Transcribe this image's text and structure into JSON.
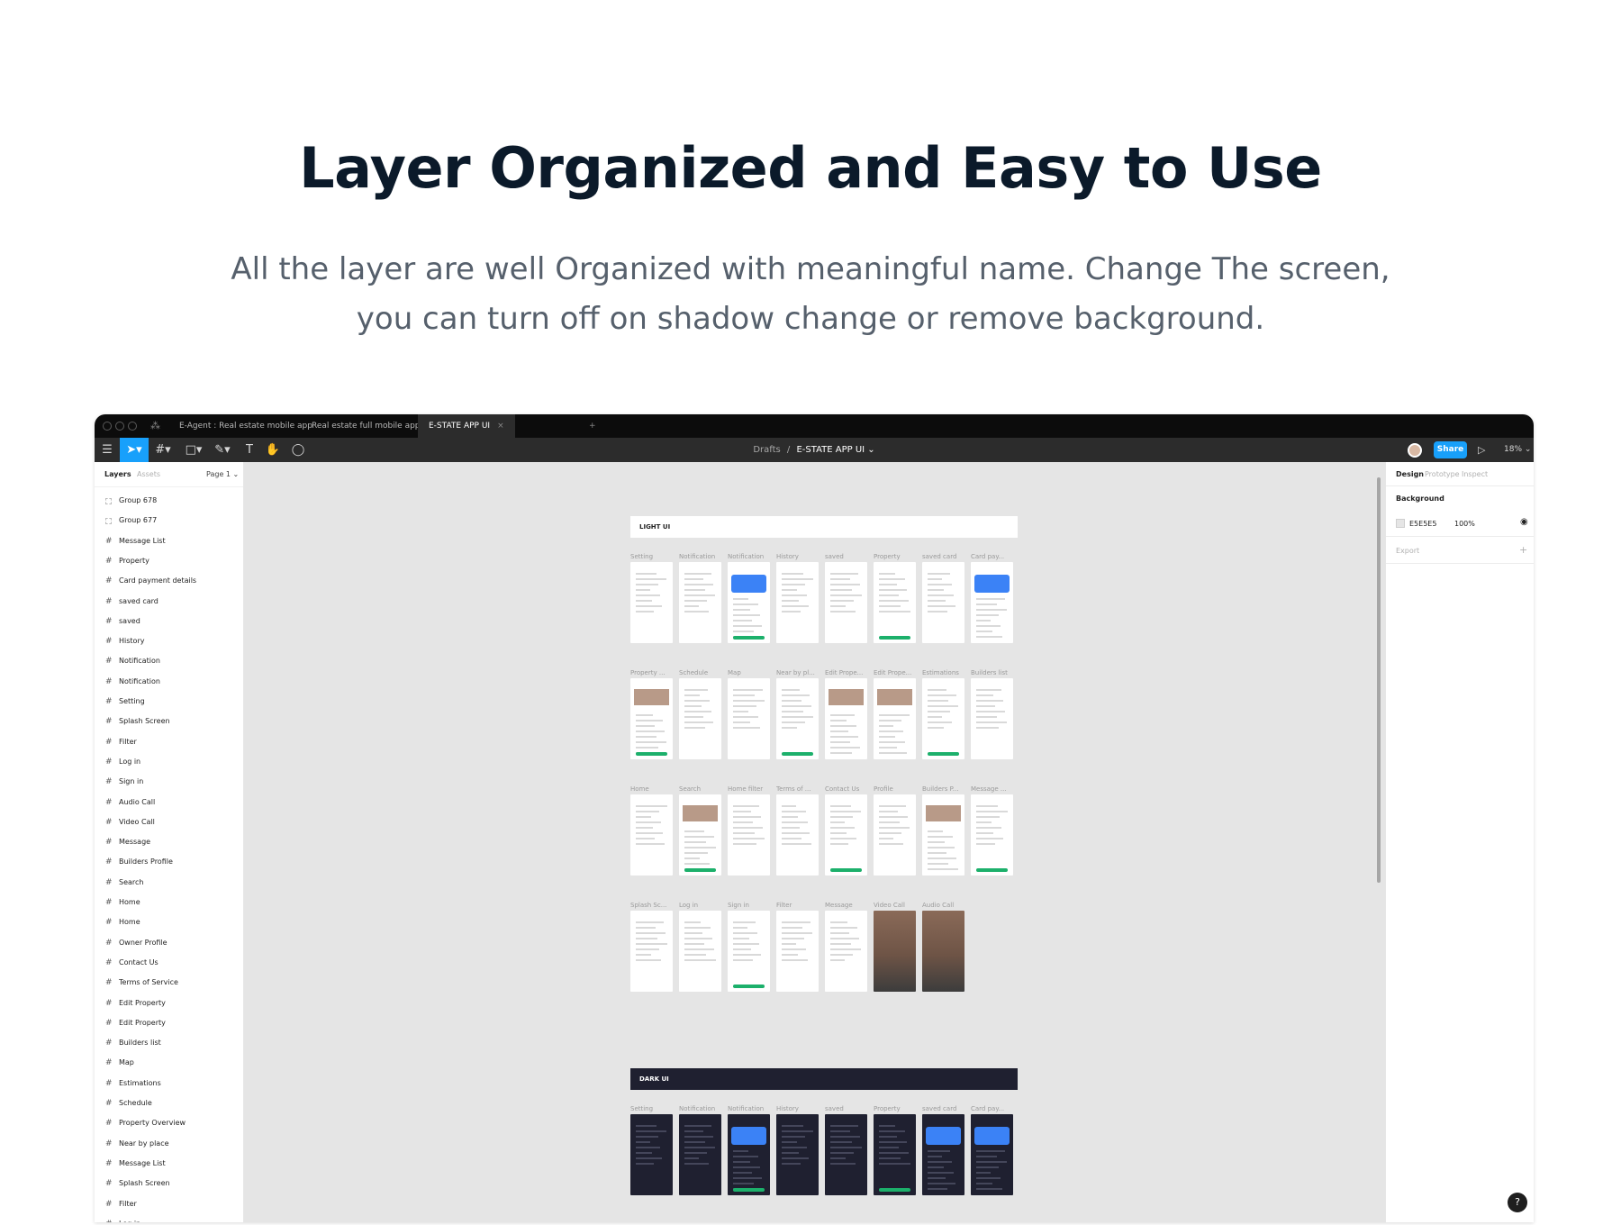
{
  "hero": {
    "title": "Layer Organized and Easy to Use",
    "subtitle_line1": "All the layer are well Organized with meaningful name. Change The screen,",
    "subtitle_line2": "you can turn off on shadow change or remove background."
  },
  "window": {
    "tabs": [
      {
        "label": "E-Agent : Real estate mobile app"
      },
      {
        "label": "Real estate full mobile app"
      },
      {
        "label": "E-STATE APP UI"
      }
    ],
    "add_tab": "+"
  },
  "toolbar": {
    "breadcrumb_root": "Drafts",
    "breadcrumb_sep": "/",
    "file_name": "E-STATE APP UI",
    "share_label": "Share",
    "zoom_label": "18%"
  },
  "left_panel": {
    "tab_layers": "Layers",
    "tab_assets": "Assets",
    "page_label": "Page 1",
    "layers": [
      {
        "name": "Group 678",
        "kind": "group"
      },
      {
        "name": "Group 677",
        "kind": "group"
      },
      {
        "name": "Message List",
        "kind": "frame"
      },
      {
        "name": "Property",
        "kind": "frame"
      },
      {
        "name": "Card payment details",
        "kind": "frame"
      },
      {
        "name": "saved card",
        "kind": "frame"
      },
      {
        "name": "saved",
        "kind": "frame"
      },
      {
        "name": "History",
        "kind": "frame"
      },
      {
        "name": "Notification",
        "kind": "frame"
      },
      {
        "name": "Notification",
        "kind": "frame"
      },
      {
        "name": "Setting",
        "kind": "frame"
      },
      {
        "name": "Splash Screen",
        "kind": "frame"
      },
      {
        "name": "Filter",
        "kind": "frame"
      },
      {
        "name": "Log in",
        "kind": "frame"
      },
      {
        "name": "Sign in",
        "kind": "frame"
      },
      {
        "name": "Audio Call",
        "kind": "frame"
      },
      {
        "name": "Video Call",
        "kind": "frame"
      },
      {
        "name": "Message",
        "kind": "frame"
      },
      {
        "name": "Builders Profile",
        "kind": "frame"
      },
      {
        "name": "Search",
        "kind": "frame"
      },
      {
        "name": "Home",
        "kind": "frame"
      },
      {
        "name": "Home",
        "kind": "frame"
      },
      {
        "name": "Owner Profile",
        "kind": "frame"
      },
      {
        "name": "Contact Us",
        "kind": "frame"
      },
      {
        "name": "Terms of Service",
        "kind": "frame"
      },
      {
        "name": "Edit Property",
        "kind": "frame"
      },
      {
        "name": "Edit Property",
        "kind": "frame"
      },
      {
        "name": "Builders list",
        "kind": "frame"
      },
      {
        "name": "Map",
        "kind": "frame"
      },
      {
        "name": "Estimations",
        "kind": "frame"
      },
      {
        "name": "Schedule",
        "kind": "frame"
      },
      {
        "name": "Property Overview",
        "kind": "frame"
      },
      {
        "name": "Near by place",
        "kind": "frame"
      },
      {
        "name": "Message List",
        "kind": "frame"
      },
      {
        "name": "Splash Screen",
        "kind": "frame"
      },
      {
        "name": "Filter",
        "kind": "frame"
      },
      {
        "name": "Log in",
        "kind": "frame"
      }
    ]
  },
  "right_panel": {
    "tab_design": "Design",
    "tab_prototype": "Prototype",
    "tab_inspect": "Inspect",
    "background_label": "Background",
    "background_hex": "E5E5E5",
    "background_opacity": "100%",
    "export_label": "Export",
    "export_add": "+"
  },
  "canvas": {
    "light_label": "LIGHT UI",
    "dark_label": "DARK UI",
    "light_rows": [
      [
        "Setting",
        "Notification",
        "Notification",
        "History",
        "saved",
        "Property",
        "saved card",
        "Card pay..."
      ],
      [
        "Property ...",
        "Schedule",
        "Map",
        "Near by pl...",
        "Edit Prope...",
        "Edit Prope...",
        "Estimations",
        "Builders list"
      ],
      [
        "Home",
        "Search",
        "Home filter",
        "Terms of ...",
        "Contact Us",
        "Profile",
        "Builders P...",
        "Message ..."
      ],
      [
        "Splash Sc...",
        "Log in",
        "Sign in",
        "Filter",
        "Message",
        "Video Call",
        "Audio Call"
      ]
    ],
    "dark_rows": [
      [
        "Setting",
        "Notification",
        "Notification",
        "History",
        "saved",
        "Property",
        "saved card",
        "Card pay..."
      ]
    ]
  },
  "help_label": "?",
  "colors": {
    "accent": "#18a0fb",
    "canvas_bg": "#E5E5E5",
    "dark_section": "#1f2030",
    "success": "#1cb06b"
  }
}
